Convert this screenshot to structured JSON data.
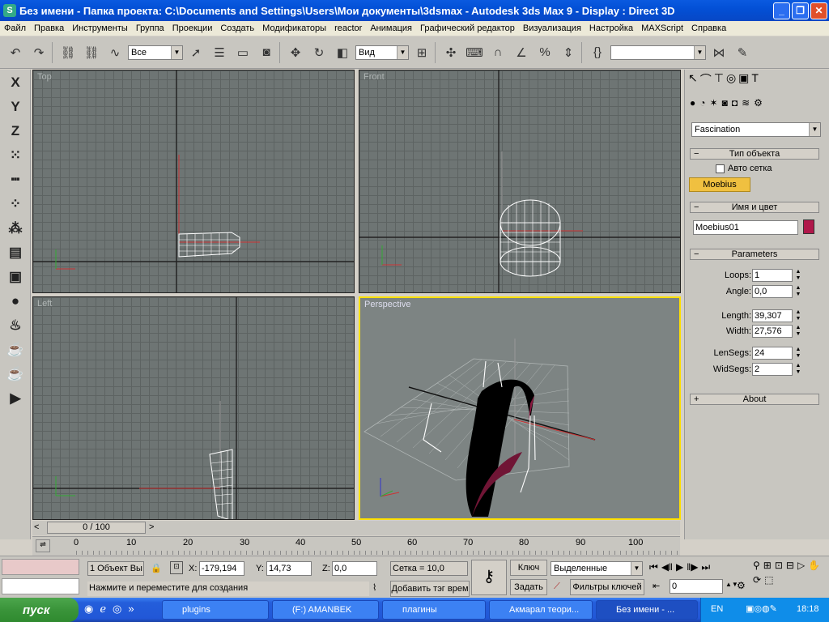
{
  "window": {
    "title": "Без имени     - Папка проекта: C:\\Documents and Settings\\Users\\Мои документы\\3dsmax     - Autodesk 3ds Max 9     - Display : Direct 3D",
    "minimize_icon": "minimize-icon",
    "restore_icon": "restore-icon",
    "close_icon": "close-icon"
  },
  "menu": [
    "Файл",
    "Правка",
    "Инструменты",
    "Группа",
    "Проекции",
    "Создать",
    "Модификаторы",
    "reactor",
    "Анимация",
    "Графический редактор",
    "Визуализация",
    "Настройка",
    "MAXScript",
    "Справка"
  ],
  "toolbar": {
    "selection_filter": "Все",
    "reference_coord": "Вид",
    "named_selection": ""
  },
  "viewports": {
    "top": "Top",
    "front": "Front",
    "left": "Left",
    "perspective": "Perspective"
  },
  "command_panel": {
    "category": "Fascination",
    "object_type_header": "Тип объекта",
    "auto_grid": "Авто сетка",
    "object_button": "Moebius",
    "name_color_header": "Имя и цвет",
    "object_name": "Moebius01",
    "object_color": "#b0174a",
    "parameters_header": "Parameters",
    "params": [
      {
        "label": "Loops:",
        "value": "1"
      },
      {
        "label": "Angle:",
        "value": "0,0"
      },
      {
        "label": "Length:",
        "value": "39,307"
      },
      {
        "label": "Width:",
        "value": "27,576"
      },
      {
        "label": "LenSegs:",
        "value": "24"
      },
      {
        "label": "WidSegs:",
        "value": "2"
      }
    ],
    "about_header": "About"
  },
  "time": {
    "slider_label": "0 / 100",
    "ticks": [
      "0",
      "10",
      "20",
      "30",
      "40",
      "50",
      "60",
      "70",
      "80",
      "90",
      "100"
    ]
  },
  "status": {
    "selection": "1 Объект Вы",
    "x_label": "X:",
    "x": "-179,194",
    "y_label": "Y:",
    "y": "14,73",
    "z_label": "Z:",
    "z": "0,0",
    "grid": "Сетка = 10,0",
    "prompt": "Нажмите и переместите для создания",
    "add_tag": "Добавить тэг врем",
    "key_btn": "Ключ",
    "set_btn": "Задать",
    "selected_dropdown": "Выделенные",
    "key_filters": "Фильтры ключей",
    "frame": "0"
  },
  "taskbar": {
    "start": "пуск",
    "tasks": [
      "plugins",
      "(F:) AMANBEK",
      "плагины",
      "Акмарал теори...",
      "Без имени - ..."
    ],
    "lang": "EN",
    "clock": "18:18"
  }
}
